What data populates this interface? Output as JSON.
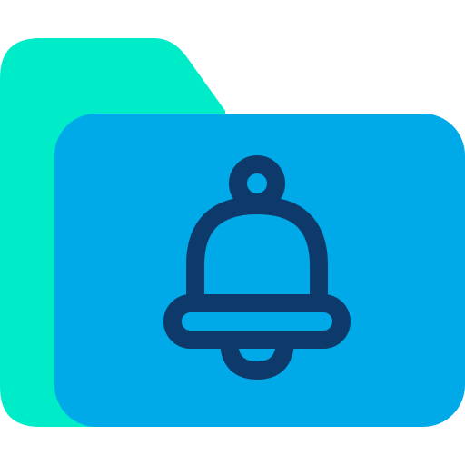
{
  "icon": {
    "name": "folder-bell-icon",
    "colors": {
      "folder_back": "#00EBC8",
      "folder_front": "#00AAE8",
      "bell_stroke": "#0E3A6B",
      "background": "#FFFFFF"
    }
  }
}
